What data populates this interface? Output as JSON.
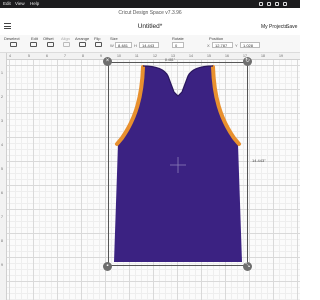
{
  "menubar": {
    "items": [
      "Edit",
      "View",
      "Help"
    ],
    "clock": ""
  },
  "header": {
    "app_title": "Cricut Design Space  v7.3.96",
    "doc_title": "Untitled*",
    "my_projects": "My Projects",
    "save": "Save"
  },
  "toolbar": {
    "deselect": "Deselect",
    "edit": "Edit",
    "offset": "Offset",
    "align": "Align",
    "arrange": "Arrange",
    "flip": "Flip",
    "size": "Size",
    "size_w_prefix": "W",
    "size_w_value": "8.481",
    "size_h_prefix": "H",
    "size_h_value": "14.443",
    "rotate": "Rotate",
    "rotate_value": "0",
    "position": "Position",
    "pos_x_prefix": "X",
    "pos_x_value": "12.787",
    "pos_y_prefix": "Y",
    "pos_y_value": "1.028"
  },
  "ruler": {
    "top": [
      "4",
      "5",
      "6",
      "7",
      "8",
      "9",
      "10",
      "11",
      "12",
      "13",
      "14",
      "15",
      "16",
      "17",
      "18",
      "19"
    ],
    "left": [
      "1",
      "2",
      "3",
      "4",
      "5",
      "6",
      "7",
      "8",
      "9"
    ]
  },
  "selection": {
    "width_label": "8.481\"",
    "height_label": "14.443\"",
    "delete_icon": "close-icon",
    "rotate_icon": "rotate-icon",
    "lock_icon": "lock-icon",
    "resize_icon": "resize-icon"
  },
  "jersey": {
    "body_color": "#3b2282",
    "trim_color": "#e8902e"
  }
}
